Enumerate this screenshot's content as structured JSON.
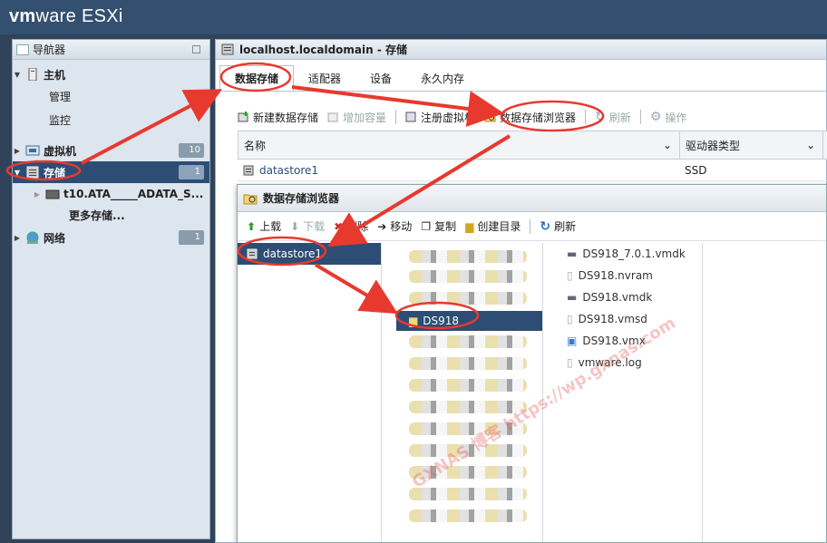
{
  "brand": {
    "prefix": "vm",
    "name": "ware",
    "product": "ESXi"
  },
  "navigator": {
    "title": "导航器",
    "host": {
      "label": "主机",
      "children": [
        "管理",
        "监控"
      ]
    },
    "vms": {
      "label": "虚拟机",
      "count": "10"
    },
    "storage": {
      "label": "存储",
      "count": "1",
      "children": [
        "t10.ATA_____ADATA_S...",
        "更多存储..."
      ]
    },
    "network": {
      "label": "网络",
      "count": "1"
    }
  },
  "main": {
    "title": "localhost.localdomain - 存储",
    "tabs": [
      "数据存储",
      "适配器",
      "设备",
      "永久内存"
    ],
    "toolbar": {
      "new_ds": "新建数据存储",
      "increase": "增加容量",
      "register": "注册虚拟机",
      "browser": "数据存储浏览器",
      "refresh": "刷新",
      "actions": "操作"
    },
    "columns": [
      "名称",
      "驱动器类型"
    ],
    "rows": [
      {
        "name": "datastore1",
        "type": "SSD"
      }
    ]
  },
  "browser": {
    "title": "数据存储浏览器",
    "toolbar": {
      "upload": "上载",
      "download": "下载",
      "delete": "删除",
      "move": "移动",
      "copy": "复制",
      "mkdir": "创建目录",
      "refresh": "刷新"
    },
    "datastore": "datastore1",
    "selected_folder": "DS918",
    "files": [
      "DS918_7.0.1.vmdk",
      "DS918.nvram",
      "DS918.vmdk",
      "DS918.vmsd",
      "DS918.vmx",
      "vmware.log"
    ]
  },
  "watermark": "GXNAS 博客 https://wp.gxnas.com",
  "colors": {
    "topbar": "#345070",
    "selection": "#2d4d74",
    "annotation": "#e8392f"
  }
}
